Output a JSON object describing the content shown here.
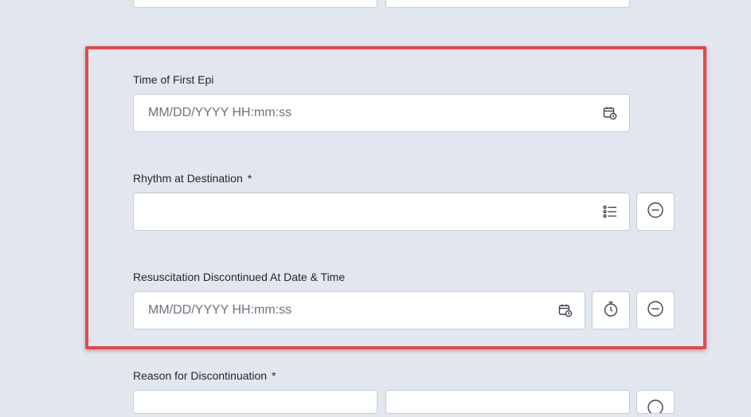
{
  "fields": {
    "time_first_epi": {
      "label": "Time of First Epi",
      "placeholder": "MM/DD/YYYY HH:mm:ss",
      "icon": "calendar-clock-icon"
    },
    "rhythm_destination": {
      "label": "Rhythm at Destination",
      "required_mark": "*",
      "value": "",
      "icon": "list-icon",
      "remove_icon": "minus-circle-icon"
    },
    "resuscitation_discontinued": {
      "label": "Resuscitation Discontinued At Date & Time",
      "placeholder": "MM/DD/YYYY HH:mm:ss",
      "icon": "calendar-clock-icon",
      "timer_icon": "stopwatch-icon",
      "remove_icon": "minus-circle-icon"
    },
    "reason_discontinuation": {
      "label": "Reason for Discontinuation",
      "required_mark": "*"
    }
  },
  "colors": {
    "background": "#e1e6ef",
    "highlight": "#e5484d",
    "field_border": "#c5ccd8"
  }
}
